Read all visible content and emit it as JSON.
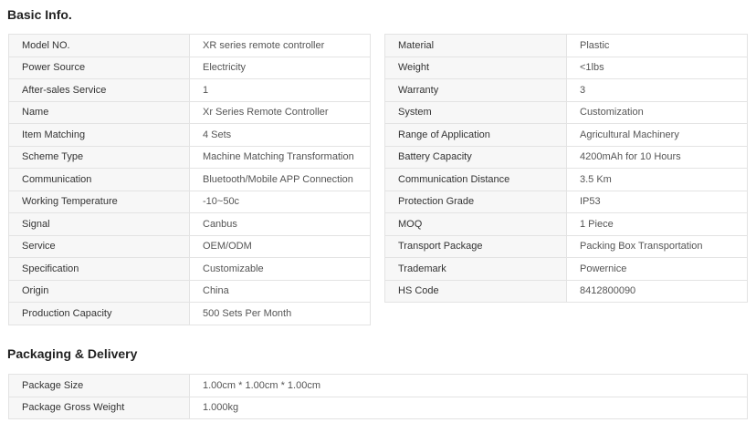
{
  "basic_info": {
    "title": "Basic Info.",
    "left_rows": [
      {
        "key": "Model NO.",
        "value": "XR series remote controller"
      },
      {
        "key": "Power Source",
        "value": "Electricity"
      },
      {
        "key": "After-sales Service",
        "value": "1"
      },
      {
        "key": "Name",
        "value": "Xr Series Remote Controller"
      },
      {
        "key": "Item Matching",
        "value": "4 Sets"
      },
      {
        "key": "Scheme Type",
        "value": "Machine Matching Transformation"
      },
      {
        "key": "Communication",
        "value": "Bluetooth/Mobile APP Connection"
      },
      {
        "key": "Working Temperature",
        "value": "-10~50c"
      },
      {
        "key": "Signal",
        "value": "Canbus"
      },
      {
        "key": "Service",
        "value": "OEM/ODM"
      },
      {
        "key": "Specification",
        "value": "Customizable"
      },
      {
        "key": "Origin",
        "value": "China"
      },
      {
        "key": "Production Capacity",
        "value": "500 Sets Per Month"
      }
    ],
    "right_rows": [
      {
        "key": "Material",
        "value": "Plastic"
      },
      {
        "key": "Weight",
        "value": "<1lbs"
      },
      {
        "key": "Warranty",
        "value": "3"
      },
      {
        "key": "System",
        "value": "Customization"
      },
      {
        "key": "Range of Application",
        "value": "Agricultural Machinery"
      },
      {
        "key": "Battery Capacity",
        "value": "4200mAh for 10 Hours"
      },
      {
        "key": "Communication Distance",
        "value": "3.5 Km"
      },
      {
        "key": "Protection Grade",
        "value": "IP53"
      },
      {
        "key": "MOQ",
        "value": "1 Piece"
      },
      {
        "key": "Transport Package",
        "value": "Packing Box Transportation"
      },
      {
        "key": "Trademark",
        "value": "Powernice"
      },
      {
        "key": "HS Code",
        "value": "8412800090"
      }
    ]
  },
  "packaging": {
    "title": "Packaging & Delivery",
    "rows": [
      {
        "key": "Package Size",
        "value": "1.00cm * 1.00cm * 1.00cm"
      },
      {
        "key": "Package Gross Weight",
        "value": "1.000kg"
      }
    ]
  }
}
